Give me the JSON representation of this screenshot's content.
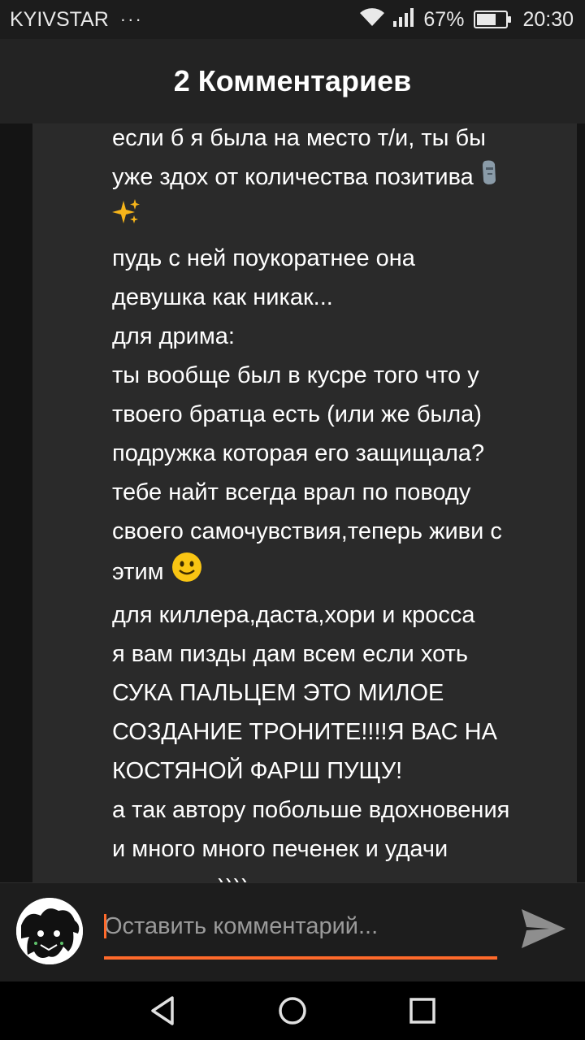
{
  "status_bar": {
    "carrier": "KYIVSTAR",
    "more_dots": "···",
    "battery_percent": "67%",
    "battery_level": 0.67,
    "time": "20:30",
    "icons": [
      "wifi-icon",
      "signal-icon",
      "battery-icon"
    ]
  },
  "header": {
    "title": "2 Комментариев"
  },
  "comment": {
    "lines": [
      "если б я была на место т/и, ты бы",
      "уже здох от количества позитива",
      "пудь с ней поукоратнее она",
      "девушка как никак...",
      "для дрима:",
      "ты вообще был в кусре того что у",
      "твоего братца есть (или же была)",
      "подружка которая его защищала?",
      "тебе найт всегда врал по поводу",
      "своего самочувствия,теперь живи с",
      "этим",
      "для киллера,даста,хори и кросса",
      "я вам пизды дам всем если хоть",
      "СУКА ПАЛЬЦЕМ ЭТО МИЛОЕ",
      "СОЗДАНИЕ ТРОНИТЕ!!!!Я ВАС НА",
      "КОСТЯНОЙ ФАРШ ПУЩУ!",
      "а так автору побольше вдохновения",
      "и много много печенек и удачи",
      "в шкалке:)))) и много чая с"
    ],
    "emojis": [
      "moai-icon",
      "sparkles-icon",
      "smiley-icon"
    ]
  },
  "compose": {
    "placeholder": "Оставить комментарий...",
    "accent_color": "#ff6a2b"
  },
  "nav": {
    "icons": [
      "back-icon",
      "home-icon",
      "recents-icon"
    ]
  }
}
